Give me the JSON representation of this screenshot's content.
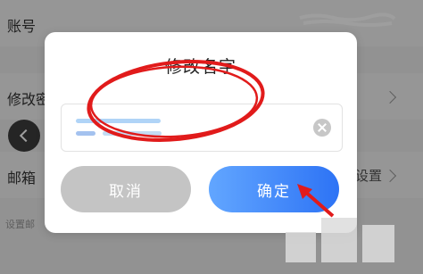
{
  "background_page": {
    "account_label": "账号",
    "change_password_label": "修改密",
    "mailbox_label": "邮箱",
    "mailbox_right_text": "设置",
    "mailbox_sub_text": "设置邮"
  },
  "dialog": {
    "title": "修改名字",
    "input_value": "",
    "cancel_label": "取消",
    "confirm_label": "确定"
  },
  "colors": {
    "confirm_gradient_start": "#62a6ff",
    "confirm_gradient_end": "#2d73f5",
    "cancel_bg": "#c4c4c4",
    "annotation_red": "#e11b1b"
  },
  "icons": [
    "back-arrow-icon",
    "clear-input-icon",
    "chevron-right-icon"
  ]
}
